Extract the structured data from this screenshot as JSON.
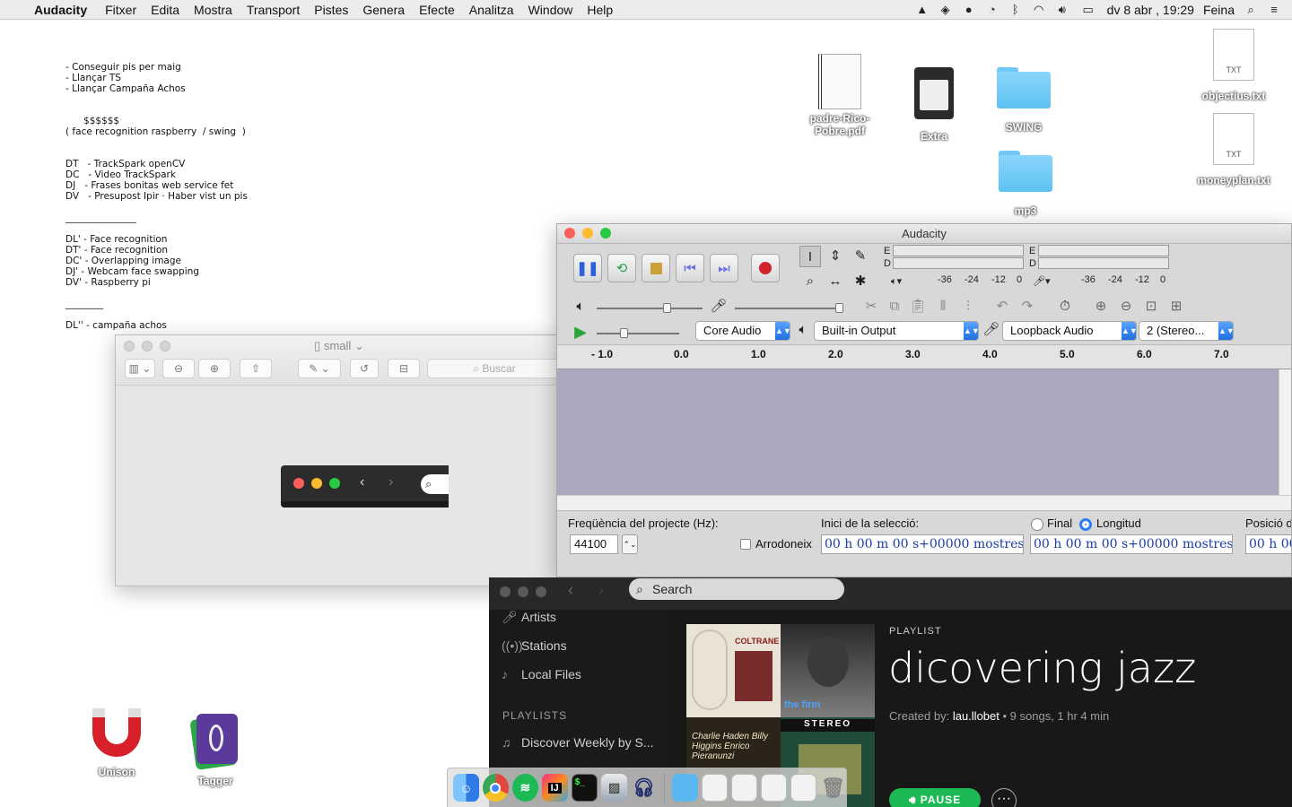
{
  "menubar": {
    "app_name": "Audacity",
    "menus": [
      "Fitxer",
      "Edita",
      "Mostra",
      "Transport",
      "Pistes",
      "Genera",
      "Efecte",
      "Analitza",
      "Window",
      "Help"
    ],
    "clock": "dv 8 abr , 19:29",
    "user": "Feina"
  },
  "desktop_note": {
    "lines": [
      "- Conseguir pis per maig",
      "- Llançar TS",
      "- Llançar Campaña Achos",
      "",
      "",
      "      $$$$$$",
      "( face recognition raspberry  / swing  )",
      "",
      "",
      "DT   - TrackSpark openCV",
      "DC   - Video TrackSpark",
      "DJ   - Frases bonitas web service fet",
      "DV   - Presupost Ipir · Haber vist un pis",
      "",
      "_______________",
      "",
      "DL' - Face recognition",
      "DT' - Face recognition",
      "DC' - Overlapping image",
      "DJ' - Webcam face swapping",
      "DV' - Raspberry pi",
      "",
      "________",
      "",
      "DL'' - campaña achos"
    ]
  },
  "desktop_icons": {
    "pdf": "padre-Rico-Pobre.pdf",
    "extra": "Extra",
    "swing": "SWING",
    "mp3": "mp3",
    "objectius": "objectius.txt",
    "moneyplan": "moneyplan.txt",
    "txt_badge": "TXT",
    "unison": "Unison",
    "tagger": "Tagger"
  },
  "preview": {
    "title": "small",
    "search_placeholder": "Buscar"
  },
  "audacity": {
    "title": "Audacity",
    "meter_labels": {
      "rec": "E",
      "play": "D"
    },
    "meter_ticks": [
      "-36",
      "-24",
      "-12",
      "0"
    ],
    "host": "Core Audio",
    "output": "Built-in Output",
    "input": "Loopback Audio",
    "channels": "2 (Stereo...",
    "ruler": [
      "- 1.0",
      "0.0",
      "1.0",
      "2.0",
      "3.0",
      "4.0",
      "5.0",
      "6.0",
      "7.0"
    ],
    "selection": {
      "rate_label": "Freqüència del projecte (Hz):",
      "rate_value": "44100",
      "snap_label": "Arrodoneix",
      "start_label": "Inici de la selecció:",
      "end_label": "Final",
      "length_label": "Longitud",
      "position_label": "Posició d",
      "time_value": "00 h 00 m 00 s+00000 mostres",
      "time_value_short": "00 h 00"
    }
  },
  "spotify": {
    "search_placeholder": "Search",
    "nav": [
      "Artists",
      "Stations",
      "Local Files"
    ],
    "playlists_header": "PLAYLISTS",
    "playlist_item": "Discover Weekly by S...",
    "playlist_type": "PLAYLIST",
    "playlist_name": "dicovering jazz",
    "created_by_label": "Created by:",
    "owner": "lau.llobet",
    "meta": "• 9 songs, 1 hr 4 min",
    "pause_label": "PAUSE",
    "more_label": "···",
    "album_texts": {
      "coltrane": "COLTRANE",
      "firm": "the firm",
      "stereo": "STEREO",
      "haden": "Charlie Haden Billy Higgins Enrico Pieranunzi"
    }
  },
  "colors": {
    "accent_green": "#1db954",
    "audacity_track": "#a9a8bf",
    "mac_close": "#fc5f57",
    "mac_min": "#fdbc2e",
    "mac_max": "#28c840"
  }
}
